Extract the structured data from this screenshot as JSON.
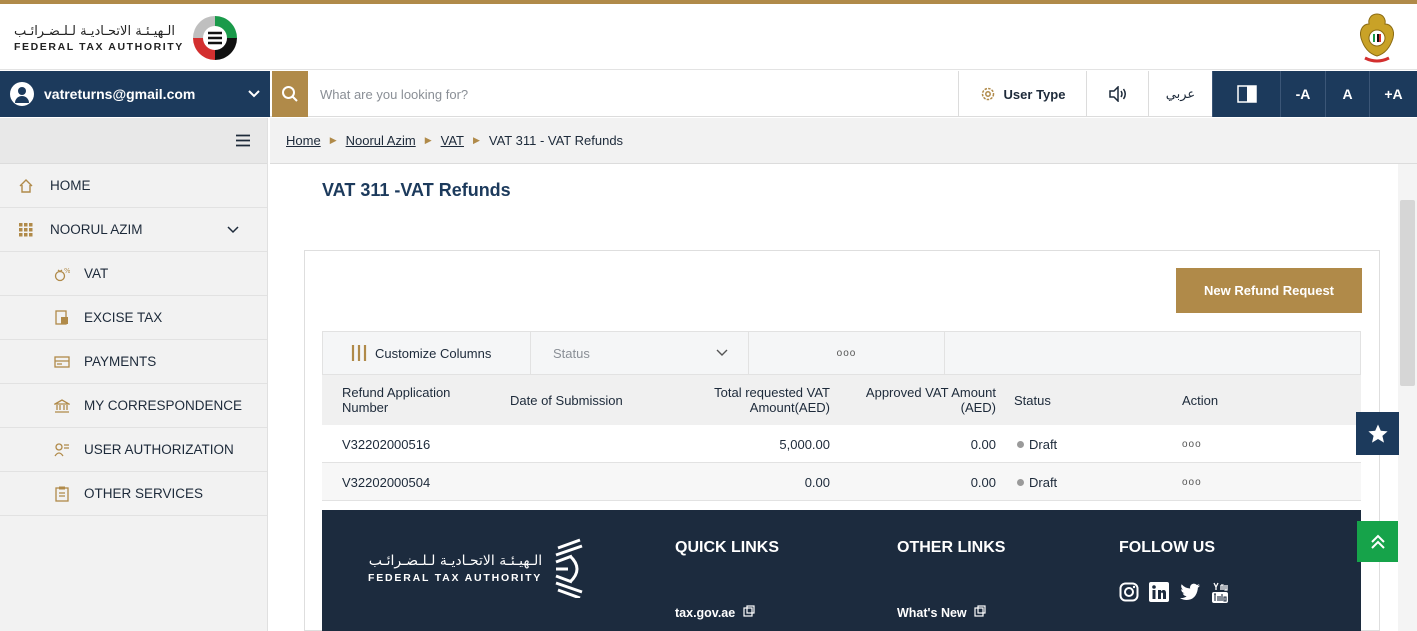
{
  "brand": {
    "arabic": "الـهيـئـة الاتحـاديـة لـلـضـرائـب",
    "english": "FEDERAL TAX AUTHORITY"
  },
  "navbar": {
    "account_email": "vatreturns@gmail.com",
    "search_placeholder": "What are you looking for?",
    "user_type": "User Type",
    "arabic_label": "عربي",
    "font_decrease": "-A",
    "font_normal": "A",
    "font_increase": "+A"
  },
  "sidebar": {
    "items": [
      {
        "label": "HOME"
      },
      {
        "label": "NOORUL AZIM"
      },
      {
        "label": "VAT"
      },
      {
        "label": "EXCISE TAX"
      },
      {
        "label": "PAYMENTS"
      },
      {
        "label": "MY CORRESPONDENCE"
      },
      {
        "label": "USER AUTHORIZATION"
      },
      {
        "label": "OTHER SERVICES"
      }
    ]
  },
  "breadcrumb": {
    "home": "Home",
    "user": "Noorul Azim",
    "vat": "VAT",
    "current": "VAT 311 - VAT Refunds"
  },
  "page": {
    "title": "VAT 311 -VAT Refunds",
    "new_button": "New Refund Request"
  },
  "toolbar": {
    "customize": "Customize Columns",
    "status_filter": "Status",
    "more": "ooo"
  },
  "table": {
    "columns": {
      "app_number": "Refund Application Number",
      "date": "Date of Submission",
      "total": "Total requested VAT Amount(AED)",
      "approved": "Approved VAT Amount (AED)",
      "status": "Status",
      "action": "Action"
    },
    "rows": [
      {
        "app_number": "V32202000516",
        "date": "",
        "total": "5,000.00",
        "approved": "0.00",
        "status": "Draft",
        "action": "ooo"
      },
      {
        "app_number": "V32202000504",
        "date": "",
        "total": "0.00",
        "approved": "0.00",
        "status": "Draft",
        "action": "ooo"
      }
    ]
  },
  "footer": {
    "arabic": "الـهيـئـة الاتحـاديـة لـلـضـرائـب",
    "english": "FEDERAL TAX AUTHORITY",
    "quick_links": "QUICK LINKS",
    "other_links": "OTHER LINKS",
    "follow_us": "FOLLOW US",
    "quick_link_1": "tax.gov.ae",
    "other_link_1": "What's New"
  },
  "colors": {
    "navy": "#1c3a5c",
    "gold": "#b08a49",
    "green": "#16a34a",
    "footer": "#1c2b3e"
  }
}
